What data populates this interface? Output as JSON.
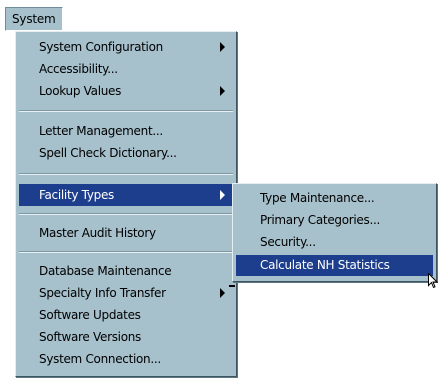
{
  "menubar": {
    "system_label": "System"
  },
  "system_menu": {
    "items": [
      {
        "label": "System Configuration"
      },
      {
        "label": "Accessibility..."
      },
      {
        "label": "Lookup Values"
      },
      {
        "label": "Letter Management..."
      },
      {
        "label": "Spell Check Dictionary..."
      },
      {
        "label": "Facility Types"
      },
      {
        "label": "Master Audit History"
      },
      {
        "label": "Database Maintenance"
      },
      {
        "label": "Specialty Info Transfer"
      },
      {
        "label": "Software Updates"
      },
      {
        "label": "Software Versions"
      },
      {
        "label": "System Connection..."
      }
    ]
  },
  "facility_types_submenu": {
    "items": [
      {
        "label": "Type Maintenance..."
      },
      {
        "label": "Primary Categories..."
      },
      {
        "label": "Security..."
      },
      {
        "label": "Calculate NH Statistics"
      }
    ]
  },
  "colors": {
    "menu_bg": "#a6c0cc",
    "highlight_bg": "#1d3e8d",
    "highlight_text": "#ffffff"
  },
  "icons": {
    "submenu_arrow": "triangle-right",
    "cursor": "arrow-pointer"
  }
}
